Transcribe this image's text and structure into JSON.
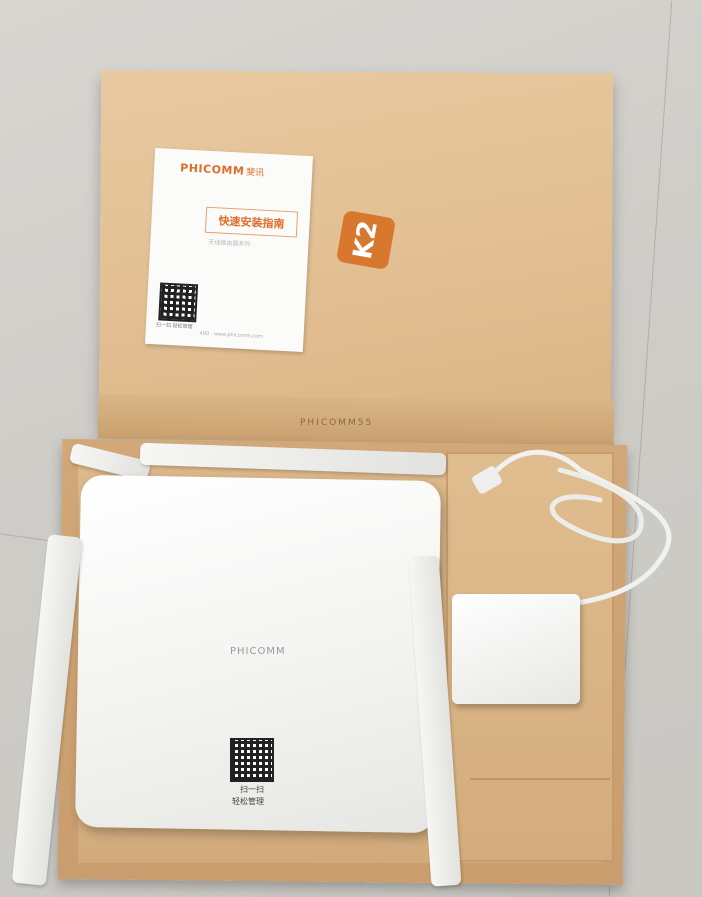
{
  "scene": {
    "lid": {
      "badge_text": "K2",
      "edge_text": "PHICOMM55"
    },
    "guide": {
      "brand": "PHICOMM",
      "brand_cn": "斐讯",
      "title": "快速安装指南",
      "subtitle": "无线路由器系列",
      "qr_caption": "扫一扫 轻松管理",
      "footer": "400  ·  www.phicomm.com"
    },
    "router": {
      "logo": "PHICOMM",
      "scan_text": "扫一扫",
      "manage_text": "轻松管理"
    },
    "colors": {
      "accent": "#d8782e",
      "cardboard": "#e2bf93",
      "router_white": "#f3f3f1"
    }
  }
}
